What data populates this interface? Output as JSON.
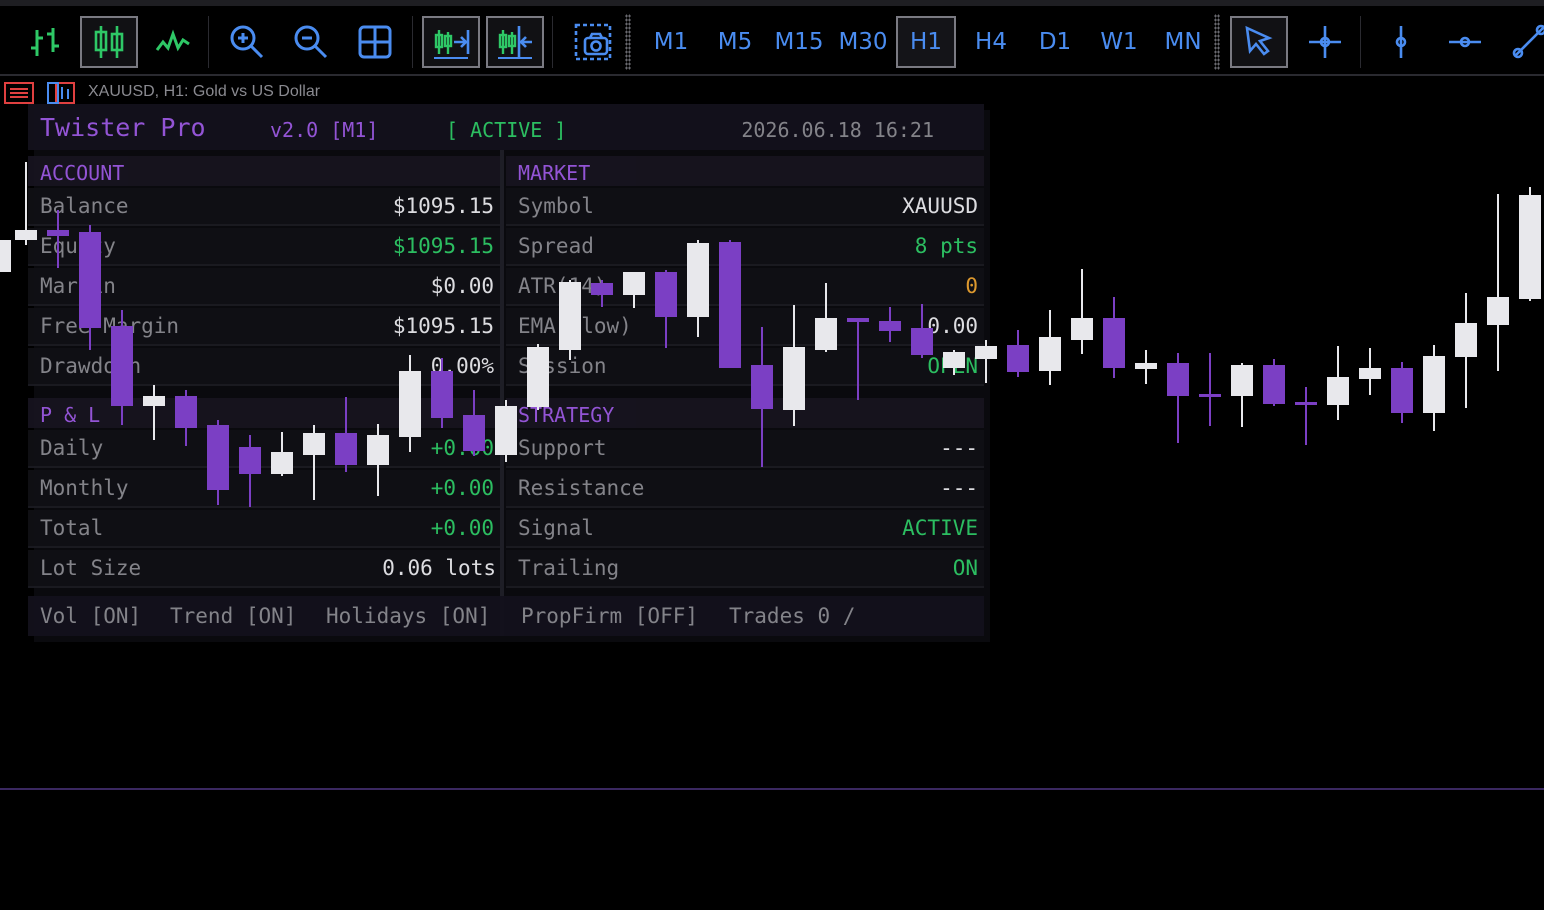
{
  "toolbar": {
    "tools": [
      {
        "name": "bar-chart-icon",
        "active": false
      },
      {
        "name": "candlestick-chart-icon",
        "active": true
      },
      {
        "name": "line-chart-icon",
        "active": false
      },
      {
        "name": "zoom-in-icon",
        "active": false
      },
      {
        "name": "zoom-out-icon",
        "active": false
      },
      {
        "name": "tile-windows-icon",
        "active": false
      },
      {
        "name": "auto-scroll-icon",
        "active": true
      },
      {
        "name": "chart-shift-icon",
        "active": true
      },
      {
        "name": "screenshot-icon",
        "active": false
      }
    ],
    "timeframes": [
      "M1",
      "M5",
      "M15",
      "M30",
      "H1",
      "H4",
      "D1",
      "W1",
      "MN"
    ],
    "active_timeframe": "H1",
    "drawing_tools": [
      "cursor-icon",
      "crosshair-icon",
      "vertical-line-icon",
      "horizontal-line-icon",
      "trendline-icon"
    ]
  },
  "chart": {
    "title": "XAUUSD, H1:  Gold vs US Dollar",
    "bull_color": "#e8e8ec",
    "bear_color": "#7b3fc4"
  },
  "dashboard": {
    "title": "Twister Pro",
    "version": "v2.0 [M1]",
    "status": "[ ACTIVE ]",
    "datetime": "2026.06.18 16:21",
    "account": {
      "header": "ACCOUNT",
      "rows": [
        {
          "label": "Balance",
          "value": "$1095.15"
        },
        {
          "label": "Equity",
          "value": "$1095.15"
        },
        {
          "label": "Margin",
          "value": "$0.00"
        },
        {
          "label": "Free Margin",
          "value": "$1095.15"
        },
        {
          "label": "Drawdown",
          "value": "0.00%"
        }
      ]
    },
    "market": {
      "header": "MARKET",
      "rows": [
        {
          "label": "Symbol",
          "value": "XAUUSD"
        },
        {
          "label": "Spread",
          "value": "8 pts"
        },
        {
          "label": "ATR(14)",
          "value": "0"
        },
        {
          "label": "EMA(slow)",
          "value": "0.00"
        },
        {
          "label": "Session",
          "value": "OPEN"
        }
      ]
    },
    "pnl": {
      "header": "P & L",
      "rows": [
        {
          "label": "Daily",
          "value": "+0.00"
        },
        {
          "label": "Monthly",
          "value": "+0.00"
        },
        {
          "label": "Total",
          "value": "+0.00"
        },
        {
          "label": "Lot Size",
          "value": "0.06 lots"
        }
      ]
    },
    "strategy": {
      "header": "STRATEGY",
      "rows": [
        {
          "label": "Support",
          "value": "---"
        },
        {
          "label": "Resistance",
          "value": "---"
        },
        {
          "label": "Signal",
          "value": "ACTIVE"
        },
        {
          "label": "Trailing",
          "value": "ON"
        }
      ]
    },
    "footer": {
      "vol": "Vol [ON]",
      "trend": "Trend [ON]",
      "holidays": "Holidays [ON]",
      "propfirm": "PropFirm [OFF]",
      "trades": "Trades 0 /"
    }
  }
}
